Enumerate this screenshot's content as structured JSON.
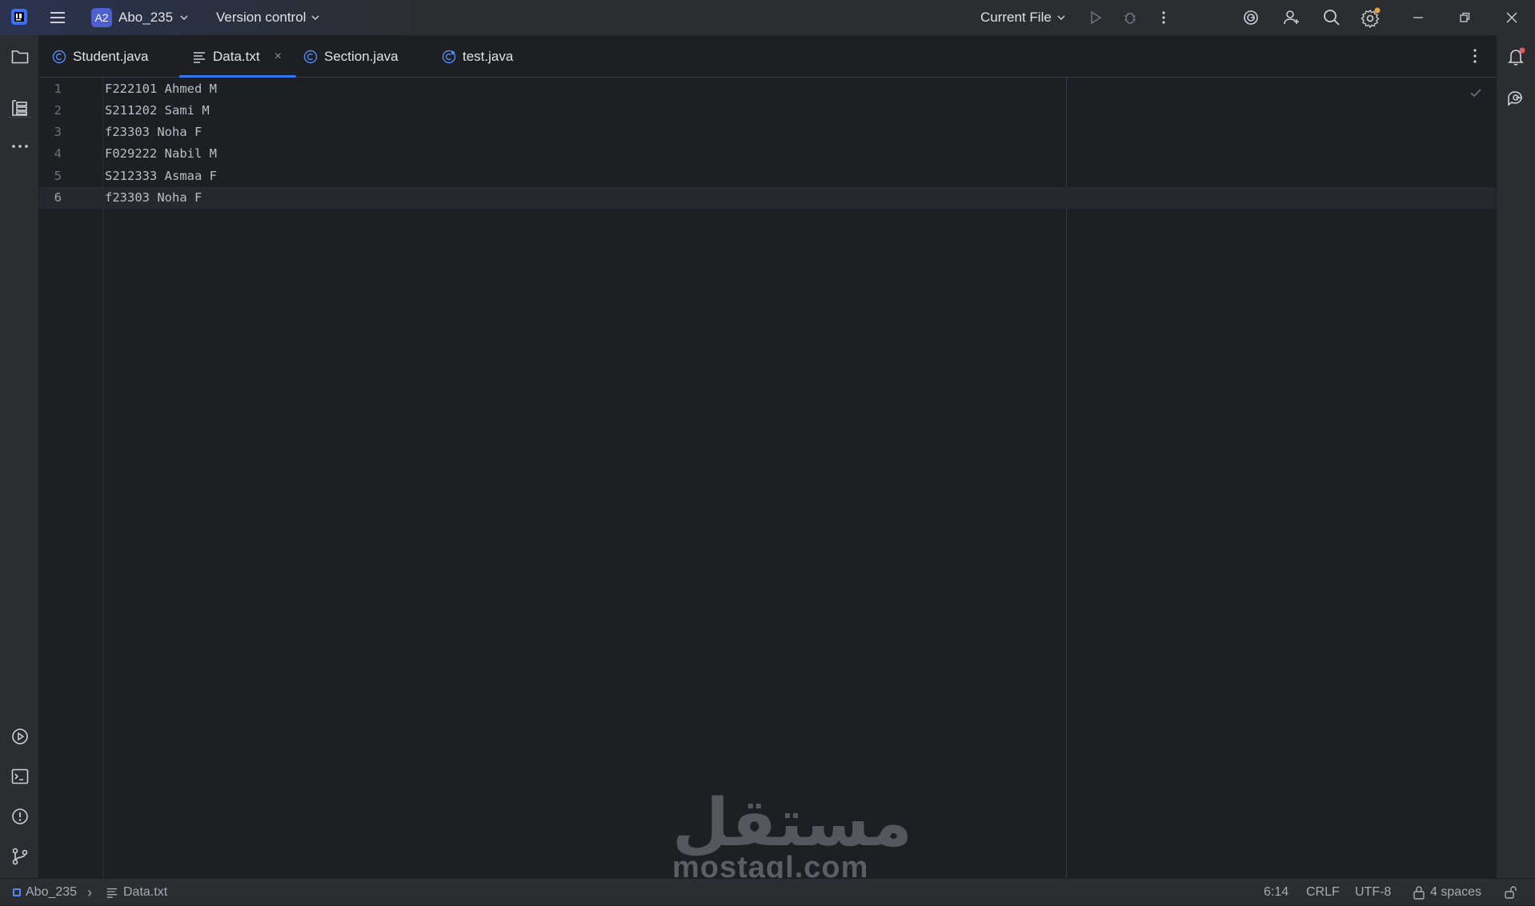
{
  "titlebar": {
    "project_badge": "A2",
    "project_name": "Abo_235",
    "vcs_label": "Version control",
    "run_config": "Current File"
  },
  "tabs": [
    {
      "label": "Student.java",
      "icon": "class-icon",
      "active": false
    },
    {
      "label": "Data.txt",
      "icon": "text-file-icon",
      "active": true
    },
    {
      "label": "Section.java",
      "icon": "class-icon",
      "active": false
    },
    {
      "label": "test.java",
      "icon": "class-icon",
      "active": false
    }
  ],
  "tab_close_glyph": "×",
  "editor": {
    "lines": [
      {
        "number": "1",
        "text": "F222101 Ahmed M"
      },
      {
        "number": "2",
        "text": "S211202 Sami M"
      },
      {
        "number": "3",
        "text": "f23303 Noha F"
      },
      {
        "number": "4",
        "text": "F029222 Nabil M"
      },
      {
        "number": "5",
        "text": "S212333 Asmaa F"
      },
      {
        "number": "6",
        "text": "f23303 Noha F"
      }
    ],
    "current_line": 6
  },
  "watermark": {
    "arabic": "مستقل",
    "latin": "mostaql.com"
  },
  "statusbar": {
    "breadcrumb_project": "Abo_235",
    "breadcrumb_separator": "›",
    "breadcrumb_file": "Data.txt",
    "caret_position": "6:14",
    "line_separator": "CRLF",
    "encoding": "UTF-8",
    "indent": "4 spaces"
  },
  "colors": {
    "accent": "#3574f0",
    "project_badge": "#4e5fd1",
    "notification_dot": "#e55b5b",
    "settings_dot": "#e8a33d"
  }
}
